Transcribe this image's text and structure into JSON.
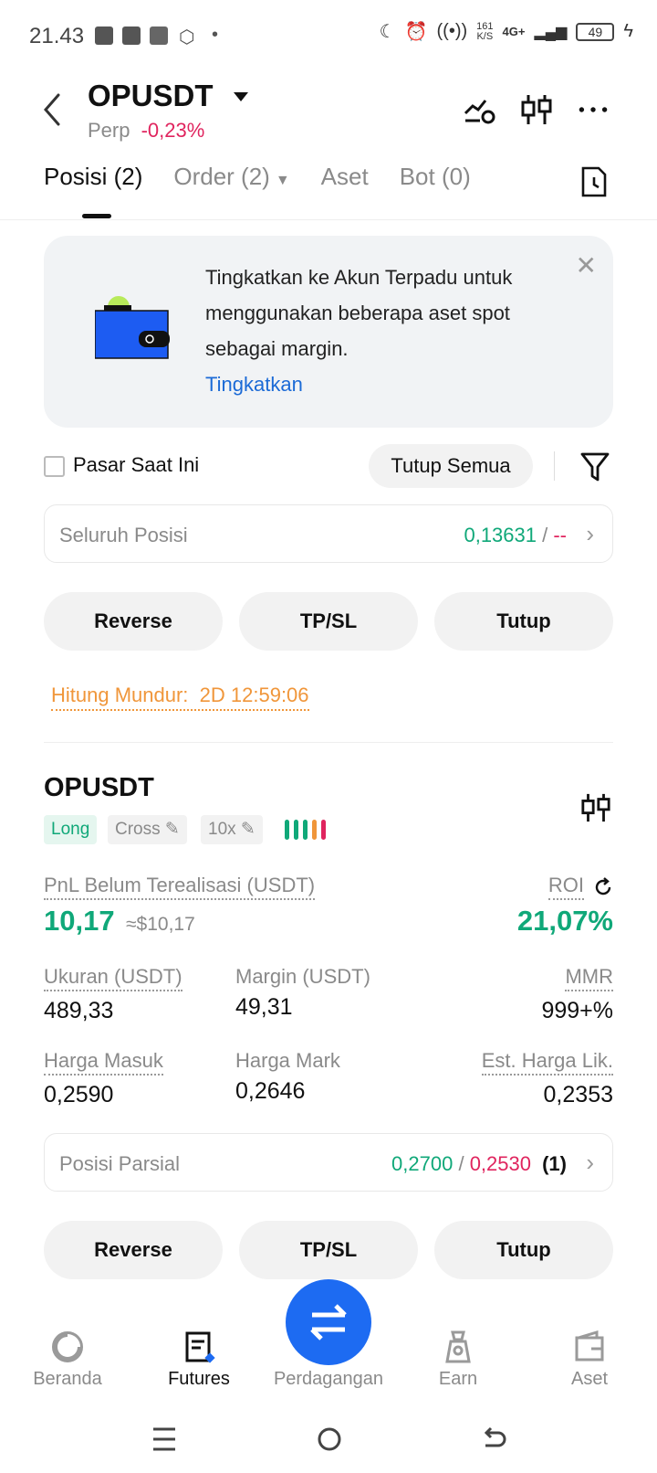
{
  "status_bar": {
    "time": "21.43",
    "net_speed_value": "161",
    "net_speed_unit": "K/S",
    "network": "4G+",
    "battery": "49"
  },
  "header": {
    "pair": "OPUSDT",
    "type": "Perp",
    "change": "-0,23%"
  },
  "tabs": [
    {
      "label": "Posisi (2)",
      "active": true
    },
    {
      "label": "Order (2)",
      "active": false
    },
    {
      "label": "Aset",
      "active": false
    },
    {
      "label": "Bot (0)",
      "active": false
    }
  ],
  "promo": {
    "text": "Tingkatkan ke Akun Terpadu untuk menggunakan beberapa aset spot sebagai margin.",
    "link": "Tingkatkan"
  },
  "controls": {
    "current_market": "Pasar Saat Ini",
    "close_all": "Tutup Semua"
  },
  "all_positions": {
    "label": "Seluruh Posisi",
    "value": "0,13631",
    "separator": " / ",
    "value2": "--"
  },
  "actions": {
    "reverse": "Reverse",
    "tpsl": "TP/SL",
    "close": "Tutup"
  },
  "countdown": {
    "label": "Hitung Mundur:",
    "value": "2D 12:59:06"
  },
  "position": {
    "pair": "OPUSDT",
    "side": "Long",
    "margin_mode": "Cross",
    "leverage": "10x",
    "pnl_label": "PnL Belum Terealisasi (USDT)",
    "pnl_value": "10,17",
    "pnl_usd": "≈$10,17",
    "roi_label": "ROI",
    "roi_value": "21,07%",
    "size_label": "Ukuran (USDT)",
    "size_value": "489,33",
    "margin_label": "Margin (USDT)",
    "margin_value": "49,31",
    "mmr_label": "MMR",
    "mmr_value": "999+%",
    "entry_label": "Harga Masuk",
    "entry_value": "0,2590",
    "mark_label": "Harga Mark",
    "mark_value": "0,2646",
    "liq_label": "Est. Harga Lik.",
    "liq_value": "0,2353",
    "partial_label": "Posisi Parsial",
    "partial_tp": "0,2700",
    "partial_sep": " / ",
    "partial_sl": "0,2530",
    "partial_count": "(1)"
  },
  "risk_bar_colors": [
    "#10a879",
    "#10a879",
    "#10a879",
    "#f0963a",
    "#e0245e"
  ],
  "bottom_nav": [
    {
      "label": "Beranda",
      "icon": "home-icon"
    },
    {
      "label": "Futures",
      "icon": "futures-icon"
    },
    {
      "label": "Perdagangan",
      "icon": "trade-swap-icon"
    },
    {
      "label": "Earn",
      "icon": "earn-icon"
    },
    {
      "label": "Aset",
      "icon": "wallet-icon"
    }
  ]
}
